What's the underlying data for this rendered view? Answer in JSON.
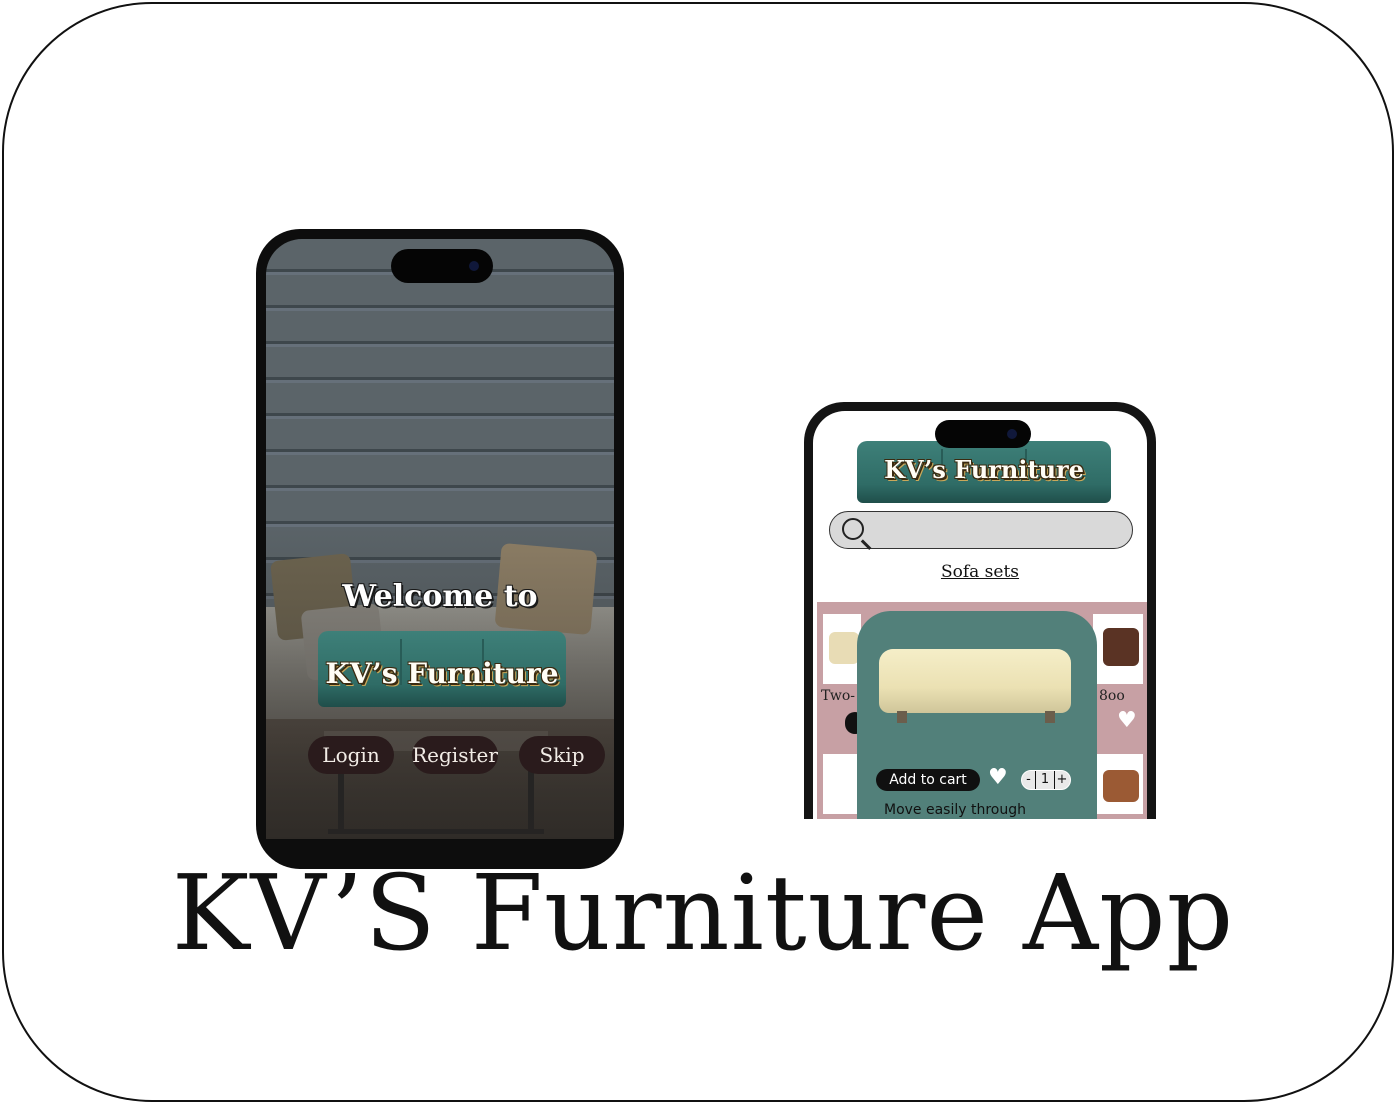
{
  "main_title": "KV’S Furniture App",
  "welcome_screen": {
    "welcome_text": "Welcome to",
    "brand": "KV’s Furniture",
    "buttons": {
      "login": "Login",
      "register": "Register",
      "skip": "Skip"
    }
  },
  "shop_screen": {
    "brand": "KV’s Furniture",
    "search": {
      "placeholder": ""
    },
    "category_tab": "Sofa sets",
    "grid_partial_labels": [
      "Two-",
      "8oo"
    ],
    "popup": {
      "add_to_cart": "Add to cart",
      "quantity": "1",
      "decrement": "-",
      "increment": "+",
      "description": "Move easily through"
    }
  },
  "colors": {
    "teal_sofa": "#2f6c66",
    "popup_bg": "#52807a",
    "pink_grid_bg": "#c7a0a4",
    "button_dark": "#2a1b1c"
  },
  "icons": [
    "search-icon",
    "heart-icon",
    "camera-icon"
  ]
}
